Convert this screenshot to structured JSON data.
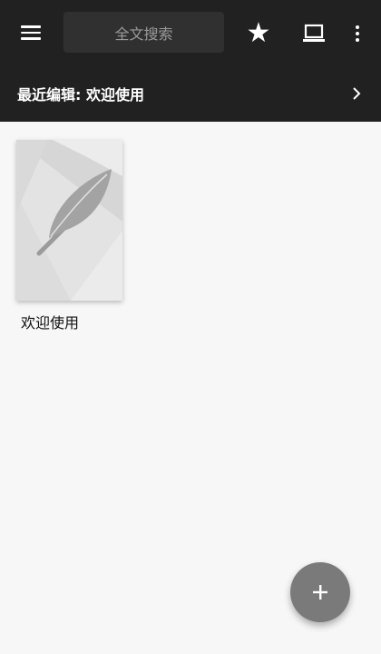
{
  "toolbar": {
    "menu_icon": "hamburger-menu-icon",
    "search_placeholder": "全文搜索",
    "star_icon": "star-icon",
    "star_glyph": "★",
    "laptop_icon": "laptop-icon",
    "more_icon": "more-vertical-icon"
  },
  "recent": {
    "label": "最近编辑: 欢迎使用",
    "chevron_icon": "chevron-right-icon"
  },
  "documents": [
    {
      "title": "欢迎使用",
      "thumbnail_icon": "feather-icon"
    }
  ],
  "fab": {
    "icon": "plus-icon"
  },
  "colors": {
    "topbar": "#212121",
    "search_box": "#303030",
    "background": "#f7f7f7",
    "fab": "#7a7a7a"
  }
}
